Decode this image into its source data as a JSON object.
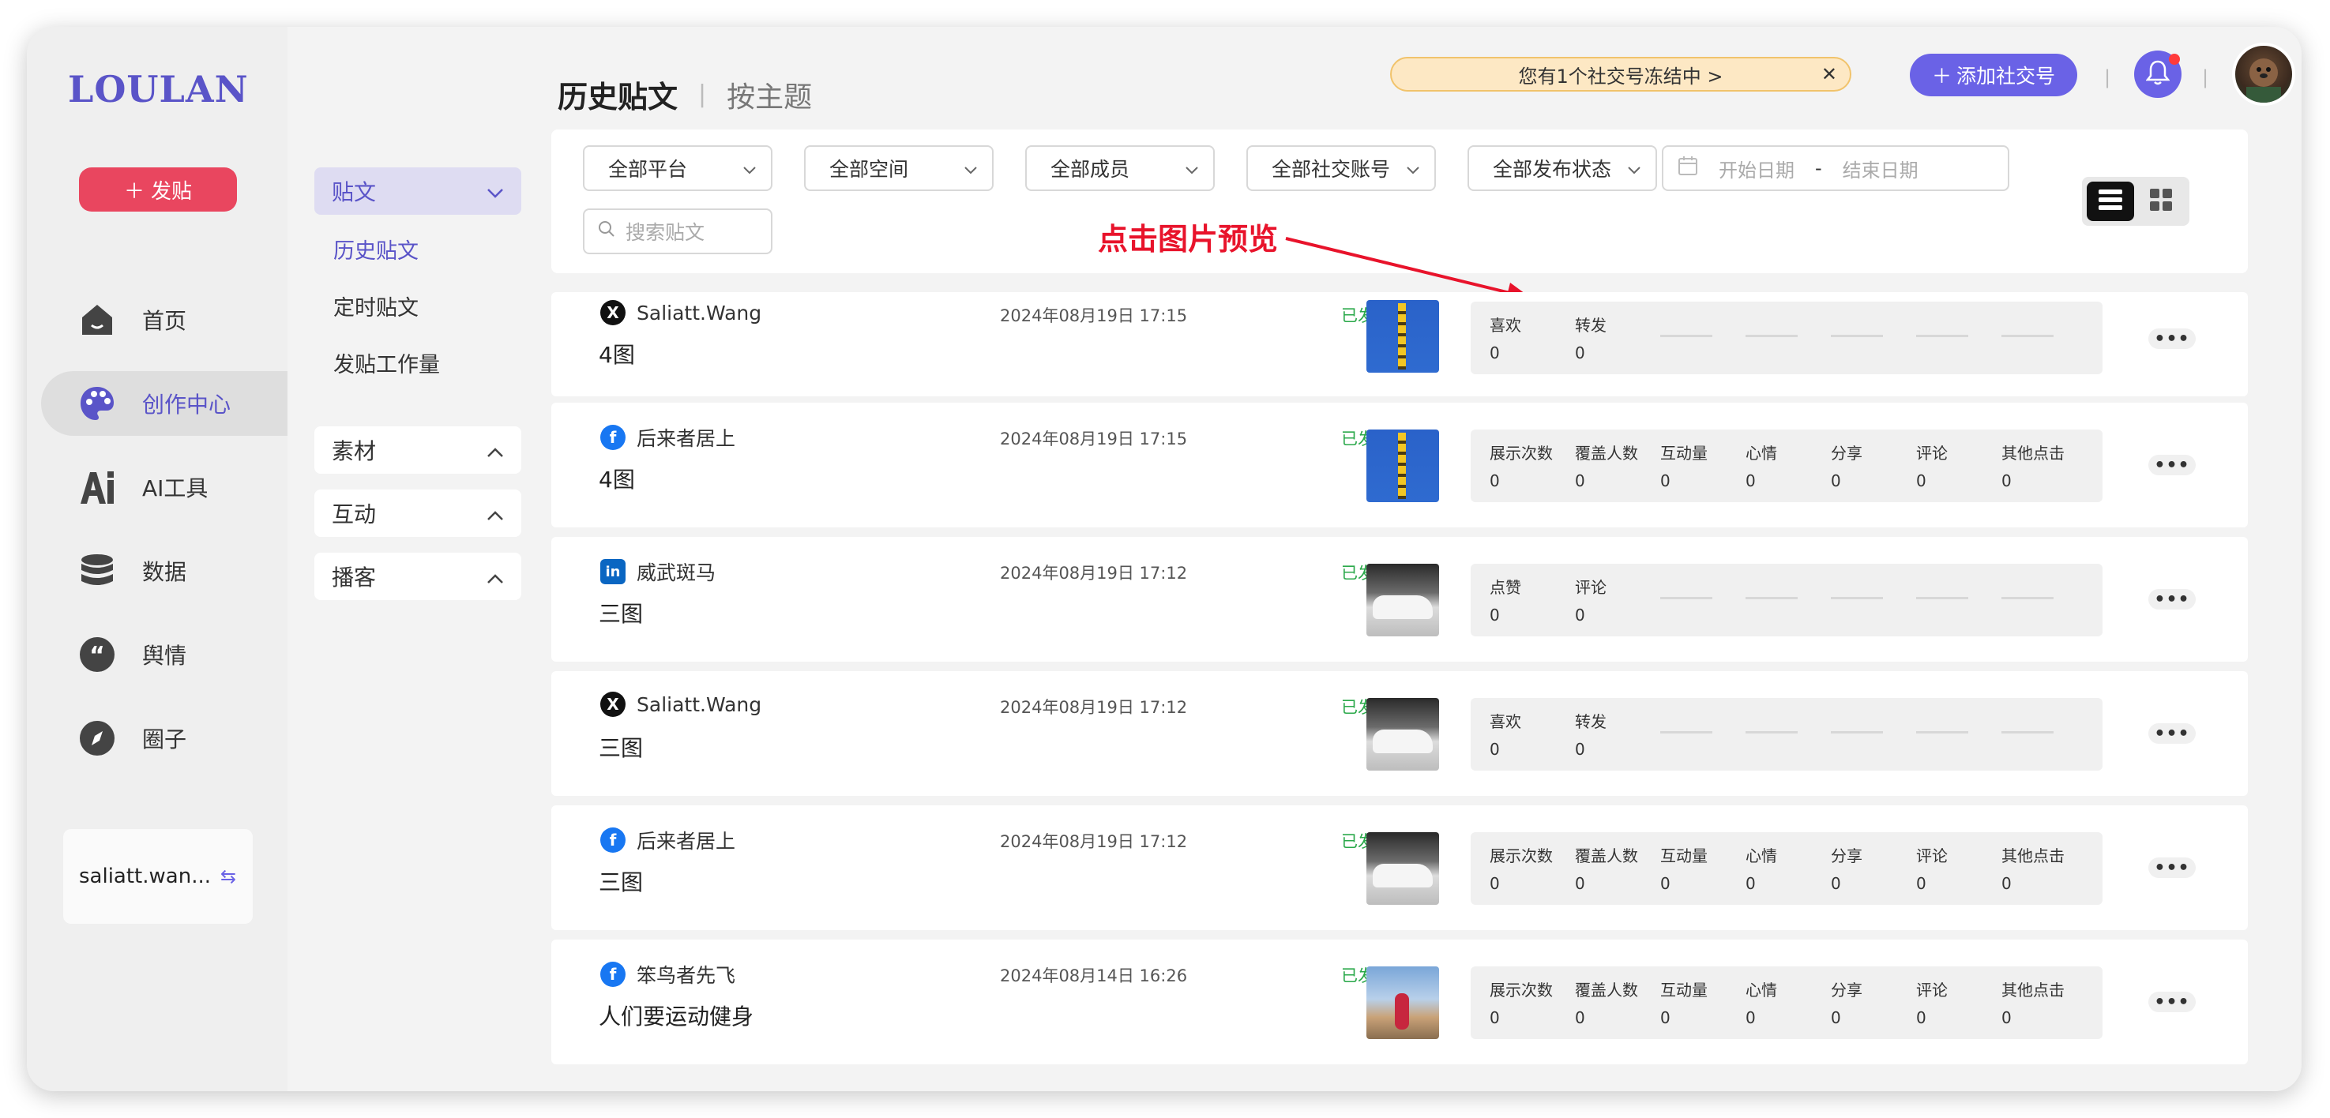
{
  "app": {
    "logo": "LOULAN",
    "post_button": "发贴",
    "nav": [
      {
        "label": "首页",
        "icon": "home-icon"
      },
      {
        "label": "创作中心",
        "icon": "palette-icon"
      },
      {
        "label": "AI工具",
        "icon": "ai-icon"
      },
      {
        "label": "数据",
        "icon": "database-icon"
      },
      {
        "label": "舆情",
        "icon": "quote-icon"
      },
      {
        "label": "圈子",
        "icon": "compass-icon"
      }
    ],
    "active_nav": "创作中心",
    "account": "saliatt.wan..."
  },
  "subnav": {
    "head": "贴文",
    "links": [
      "历史贴文",
      "定时贴文",
      "发贴工作量"
    ],
    "active_link": "历史贴文",
    "groups": [
      "素材",
      "互动",
      "播客"
    ]
  },
  "header": {
    "tab_active": "历史贴文",
    "tab_other": "按主题",
    "notice": "您有1个社交号冻结中 >",
    "add_social": "添加社交号"
  },
  "filters": {
    "platform": "全部平台",
    "space": "全部空间",
    "member": "全部成员",
    "social_account": "全部社交账号",
    "publish_status": "全部发布状态",
    "date_start": "开始日期",
    "date_sep": "-",
    "date_end": "结束日期",
    "search_placeholder": "搜索贴文"
  },
  "annotation": "点击图片预览",
  "posts": [
    {
      "platform": "x",
      "account": "Saliatt.Wang",
      "content": "4图",
      "time": "2024年08月19日 17:15",
      "status": "已发布",
      "thumb": "flowers",
      "stats": [
        {
          "label": "喜欢",
          "value": "0"
        },
        {
          "label": "转发",
          "value": "0"
        }
      ]
    },
    {
      "platform": "facebook",
      "account": "后来者居上",
      "content": "4图",
      "time": "2024年08月19日 17:15",
      "status": "已发布",
      "thumb": "flowers",
      "stats": [
        {
          "label": "展示次数",
          "value": "0"
        },
        {
          "label": "覆盖人数",
          "value": "0"
        },
        {
          "label": "互动量",
          "value": "0"
        },
        {
          "label": "心情",
          "value": "0"
        },
        {
          "label": "分享",
          "value": "0"
        },
        {
          "label": "评论",
          "value": "0"
        },
        {
          "label": "其他点击",
          "value": "0"
        }
      ]
    },
    {
      "platform": "linkedin",
      "account": "威武斑马",
      "content": "三图",
      "time": "2024年08月19日 17:12",
      "status": "已发布",
      "thumb": "car",
      "stats": [
        {
          "label": "点赞",
          "value": "0"
        },
        {
          "label": "评论",
          "value": "0"
        }
      ]
    },
    {
      "platform": "x",
      "account": "Saliatt.Wang",
      "content": "三图",
      "time": "2024年08月19日 17:12",
      "status": "已发布",
      "thumb": "car",
      "stats": [
        {
          "label": "喜欢",
          "value": "0"
        },
        {
          "label": "转发",
          "value": "0"
        }
      ]
    },
    {
      "platform": "facebook",
      "account": "后来者居上",
      "content": "三图",
      "time": "2024年08月19日 17:12",
      "status": "已发布",
      "thumb": "car",
      "stats": [
        {
          "label": "展示次数",
          "value": "0"
        },
        {
          "label": "覆盖人数",
          "value": "0"
        },
        {
          "label": "互动量",
          "value": "0"
        },
        {
          "label": "心情",
          "value": "0"
        },
        {
          "label": "分享",
          "value": "0"
        },
        {
          "label": "评论",
          "value": "0"
        },
        {
          "label": "其他点击",
          "value": "0"
        }
      ]
    },
    {
      "platform": "facebook",
      "account": "笨鸟者先飞",
      "content": "人们要运动健身",
      "time": "2024年08月14日 16:26",
      "status": "已发布",
      "thumb": "sport",
      "stats": [
        {
          "label": "展示次数",
          "value": "0"
        },
        {
          "label": "覆盖人数",
          "value": "0"
        },
        {
          "label": "互动量",
          "value": "0"
        },
        {
          "label": "心情",
          "value": "0"
        },
        {
          "label": "分享",
          "value": "0"
        },
        {
          "label": "评论",
          "value": "0"
        },
        {
          "label": "其他点击",
          "value": "0"
        }
      ]
    }
  ],
  "colors": {
    "brand": "#5a54c8",
    "accent": "#6a62e6",
    "danger": "#e9465f",
    "published": "#2aa84a",
    "annotation": "#e8132b"
  }
}
